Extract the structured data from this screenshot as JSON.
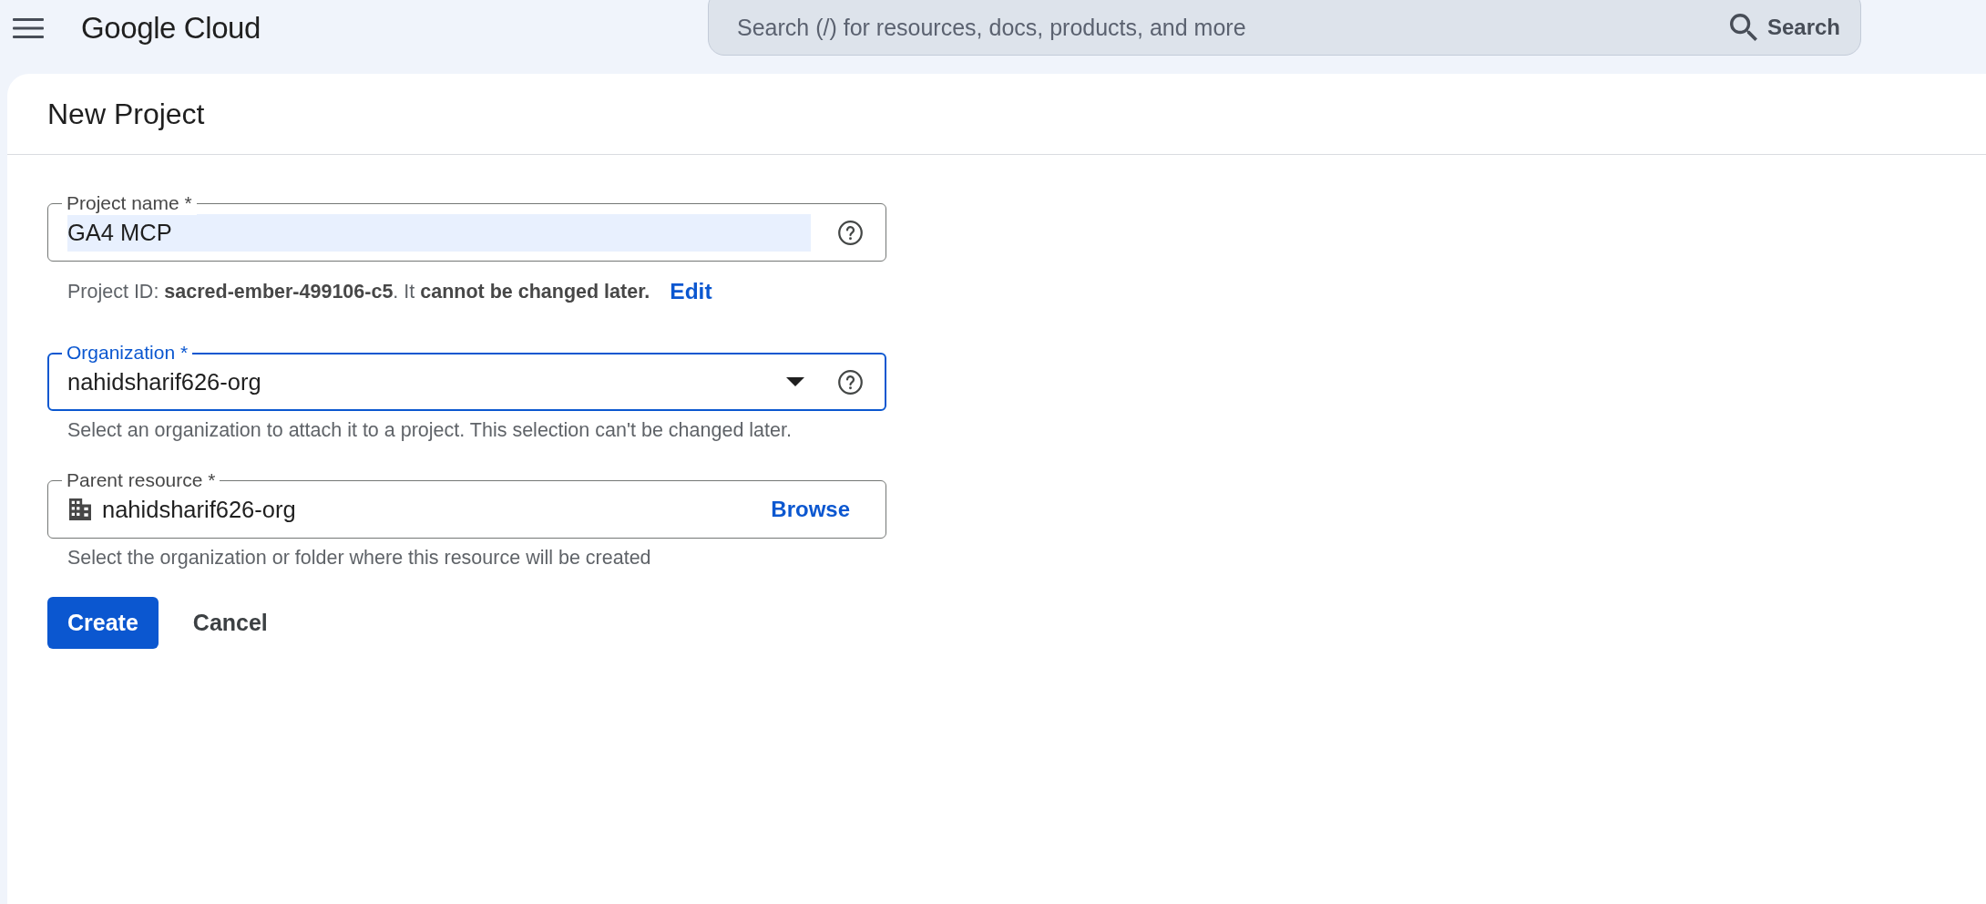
{
  "header": {
    "brand": "Google Cloud",
    "search": {
      "placeholder": "Search (/) for resources, docs, products, and more",
      "button": "Search"
    }
  },
  "page": {
    "title": "New Project"
  },
  "fields": [
    {
      "kind": "text",
      "label": "Project name *",
      "value": "GA4 MCP",
      "autofilled": true,
      "focused": false,
      "help": true,
      "helper": "Project ID: **sacred-ember-499106-c5**. It **cannot be changed later.**",
      "link": "Edit"
    },
    {
      "kind": "select",
      "label": "Organization *",
      "value": "nahidsharif626-org",
      "autofilled": false,
      "focused": true,
      "help": true,
      "helper": "Select an organization to attach it to a project. This selection can't be changed later."
    },
    {
      "kind": "resource",
      "label": "Parent resource *",
      "value": "nahidsharif626-org",
      "autofilled": false,
      "focused": false,
      "help": false,
      "action": "Browse",
      "helper": "Select the organization or folder where this resource will be created"
    }
  ],
  "actions": [
    {
      "label": "Create",
      "kind": "primary"
    },
    {
      "label": "Cancel",
      "kind": "text"
    }
  ]
}
